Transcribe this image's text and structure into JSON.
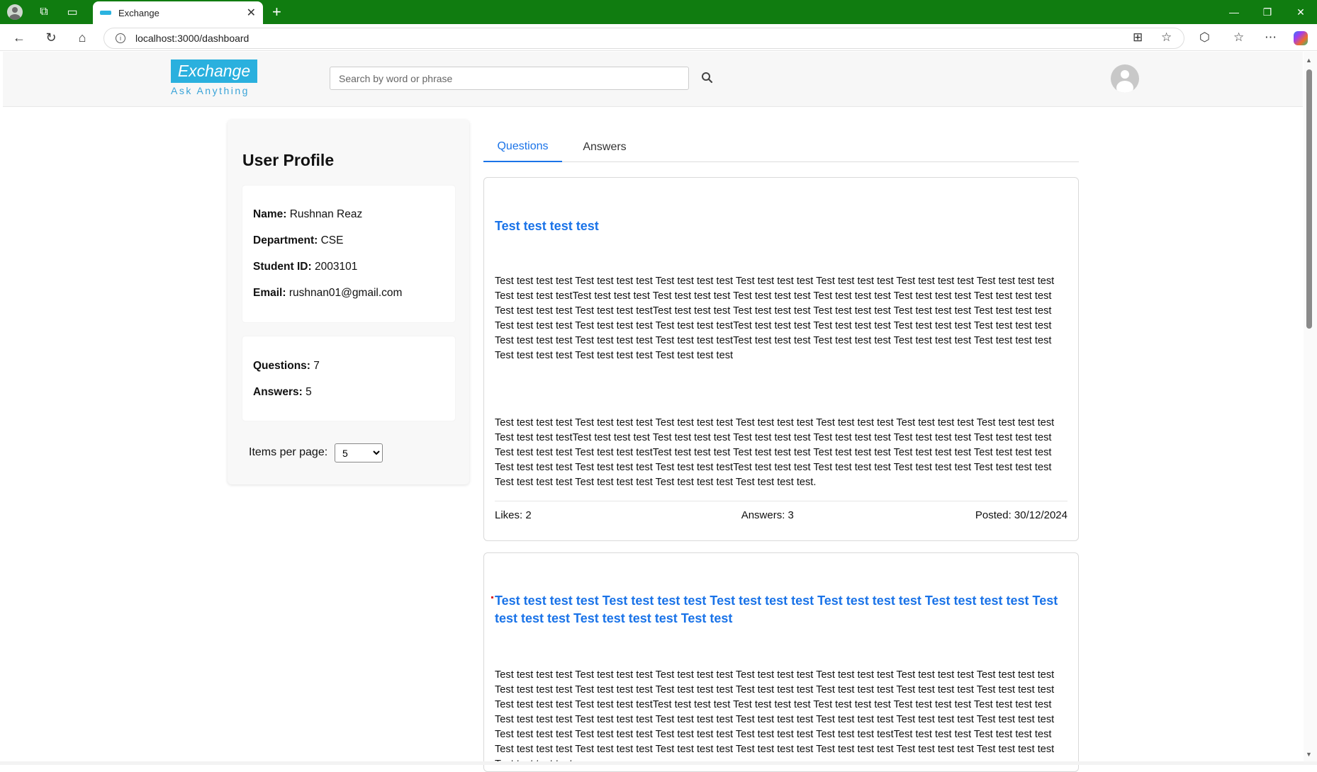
{
  "browser": {
    "tab_title": "Exchange",
    "url": "localhost:3000/dashboard",
    "new_tab": "+",
    "tab_close": "✕"
  },
  "header": {
    "logo": "Exchange",
    "tagline": "Ask Anything",
    "search_placeholder": "Search by word or phrase"
  },
  "profile": {
    "title": "User Profile",
    "name_label": "Name:",
    "name": "Rushnan Reaz",
    "department_label": "Department:",
    "department": "CSE",
    "student_id_label": "Student ID:",
    "student_id": "2003101",
    "email_label": "Email:",
    "email": "rushnan01@gmail.com",
    "questions_label": "Questions:",
    "questions": "7",
    "answers_label": "Answers:",
    "answers": "5",
    "items_per_page_label": "Items per page:",
    "items_per_page_value": "5"
  },
  "tabs": {
    "questions": "Questions",
    "answers": "Answers"
  },
  "questions": [
    {
      "title": "Test test test test",
      "para1": "Test test test test Test test test test Test test test test Test test test test Test test test test Test test test test Test test test test Test test test testTest test test test Test test test test Test test test test Test test test test Test test test test Test test test test Test test test test Test test test testTest test test test Test test test test Test test test test Test test test test Test test test test Test test test test Test test test test Test test test testTest test test test Test test test test Test test test test Test test test test Test test test test Test test test test Test test test testTest test test test Test test test test Test test test test Test test test test Test test test test Test test test test Test test test test",
      "para2": "Test test test test Test test test test Test test test test Test test test test Test test test test Test test test test Test test test test Test test test testTest test test test Test test test test Test test test test Test test test test Test test test test Test test test test Test test test test Test test test testTest test test test Test test test test Test test test test Test test test test Test test test test Test test test test Test test test test Test test test testTest test test test Test test test test Test test test test Test test test test Test test test test Test test test test Test test test test Test test test test.",
      "likes": "Likes: 2",
      "answers": "Answers: 3",
      "posted": "Posted: 30/12/2024"
    },
    {
      "title": "Test test test test Test test test test Test test test test Test test test test Test test test test Test test test test Test test test test Test test",
      "para1": "Test test test test Test test test test Test test test test Test test test test Test test test test Test test test test Test test test test Test test test test Test test test test Test test test test Test test test test Test test test test Test test test test Test test test test Test test test test Test test test testTest test test test Test test test test Test test test test Test test test test Test test test test Test test test test Test test test test Test test test test Test test test test Test test test test Test test test test Test test test test Test test test test Test test test test Test test test test Test test test test Test test test testTest test test test Test test test test Test test test test Test test test test Test test test test Test test test test Test test test test Test test test test Test test test test Test test test test"
    }
  ]
}
